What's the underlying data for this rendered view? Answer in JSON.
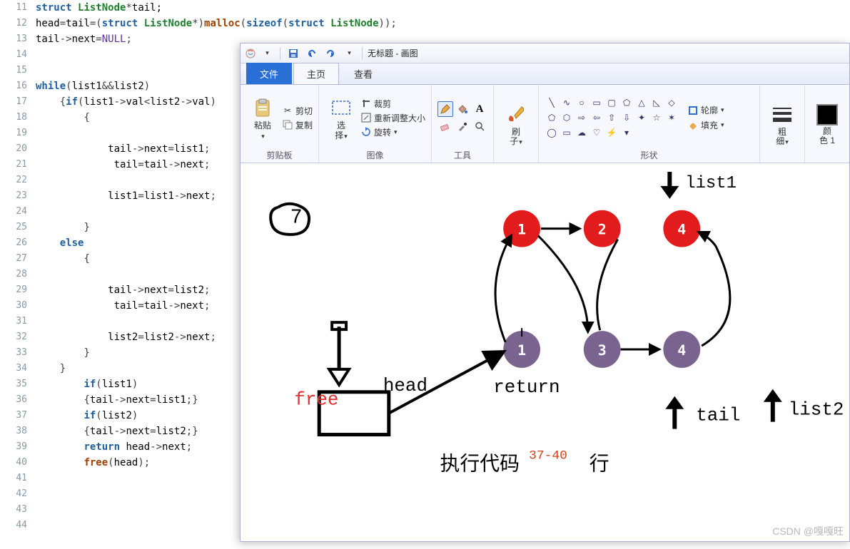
{
  "code": {
    "lines": [
      {
        "n": 11,
        "html": "<span class='kw'>struct</span> <span class='tp'>ListNode</span><span class='op'>*</span><span class='pln'>tail;</span>"
      },
      {
        "n": 12,
        "html": "<span class='pln'>head</span><span class='op'>=</span><span class='pln'>tail</span><span class='op'>=(</span><span class='kw'>struct</span> <span class='tp'>ListNode</span><span class='op'>*)</span><span class='fn'>malloc</span><span class='op'>(</span><span class='kw'>sizeof</span><span class='op'>(</span><span class='kw'>struct</span> <span class='tp'>ListNode</span><span class='op'>));</span>"
      },
      {
        "n": 13,
        "html": "<span class='pln'>tail</span><span class='op'>-&gt;</span><span class='pln'>next</span><span class='op'>=</span><span class='cnst'>NULL</span><span class='op'>;</span>"
      },
      {
        "n": 14,
        "html": ""
      },
      {
        "n": 15,
        "html": ""
      },
      {
        "n": 16,
        "html": "<span class='kw'>while</span><span class='op'>(</span><span class='pln'>list1</span><span class='op'>&amp;&amp;</span><span class='pln'>list2</span><span class='op'>)</span>"
      },
      {
        "n": 17,
        "html": "    <span class='op'>{</span><span class='kw'>if</span><span class='op'>(</span><span class='pln'>list1</span><span class='op'>-&gt;</span><span class='pln'>val</span><span class='op'>&lt;</span><span class='pln'>list2</span><span class='op'>-&gt;</span><span class='pln'>val</span><span class='op'>)</span>"
      },
      {
        "n": 18,
        "html": "        <span class='op'>{</span>"
      },
      {
        "n": 19,
        "html": ""
      },
      {
        "n": 20,
        "html": "            <span class='pln'>tail</span><span class='op'>-&gt;</span><span class='pln'>next</span><span class='op'>=</span><span class='pln'>list1</span><span class='op'>;</span>"
      },
      {
        "n": 21,
        "html": "             <span class='pln'>tail</span><span class='op'>=</span><span class='pln'>tail</span><span class='op'>-&gt;</span><span class='pln'>next</span><span class='op'>;</span>"
      },
      {
        "n": 22,
        "html": ""
      },
      {
        "n": 23,
        "html": "            <span class='pln'>list1</span><span class='op'>=</span><span class='pln'>list1</span><span class='op'>-&gt;</span><span class='pln'>next</span><span class='op'>;</span>"
      },
      {
        "n": 24,
        "html": ""
      },
      {
        "n": 25,
        "html": "        <span class='op'>}</span>"
      },
      {
        "n": 26,
        "html": "    <span class='kw'>else</span>"
      },
      {
        "n": 27,
        "html": "        <span class='op'>{</span>"
      },
      {
        "n": 28,
        "html": ""
      },
      {
        "n": 29,
        "html": "            <span class='pln'>tail</span><span class='op'>-&gt;</span><span class='pln'>next</span><span class='op'>=</span><span class='pln'>list2</span><span class='op'>;</span>"
      },
      {
        "n": 30,
        "html": "             <span class='pln'>tail</span><span class='op'>=</span><span class='pln'>tail</span><span class='op'>-&gt;</span><span class='pln'>next</span><span class='op'>;</span>"
      },
      {
        "n": 31,
        "html": ""
      },
      {
        "n": 32,
        "html": "            <span class='pln'>list2</span><span class='op'>=</span><span class='pln'>list2</span><span class='op'>-&gt;</span><span class='pln'>next</span><span class='op'>;</span>"
      },
      {
        "n": 33,
        "html": "        <span class='op'>}</span>"
      },
      {
        "n": 34,
        "html": "    <span class='op'>}</span>"
      },
      {
        "n": 35,
        "html": "        <span class='kw'>if</span><span class='op'>(</span><span class='pln'>list1</span><span class='op'>)</span>"
      },
      {
        "n": 36,
        "html": "        <span class='op'>{</span><span class='pln'>tail</span><span class='op'>-&gt;</span><span class='pln'>next</span><span class='op'>=</span><span class='pln'>list1</span><span class='op'>;}</span>"
      },
      {
        "n": 37,
        "html": "        <span class='kw'>if</span><span class='op'>(</span><span class='pln'>list2</span><span class='op'>)</span>"
      },
      {
        "n": 38,
        "html": "        <span class='op'>{</span><span class='pln'>tail</span><span class='op'>-&gt;</span><span class='pln'>next</span><span class='op'>=</span><span class='pln'>list2</span><span class='op'>;}</span>"
      },
      {
        "n": 39,
        "html": "        <span class='kw'>return</span> <span class='pln'>head</span><span class='op'>-&gt;</span><span class='pln'>next</span><span class='op'>;</span>"
      },
      {
        "n": 40,
        "html": "        <span class='fn'>free</span><span class='op'>(</span><span class='pln'>head</span><span class='op'>);</span>"
      },
      {
        "n": 41,
        "html": ""
      },
      {
        "n": 42,
        "html": ""
      },
      {
        "n": 43,
        "html": ""
      },
      {
        "n": 44,
        "html": ""
      }
    ]
  },
  "paint": {
    "title": "无标题 - 画图",
    "tabs": {
      "file": "文件",
      "home": "主页",
      "view": "查看"
    },
    "groups": {
      "clipboard": {
        "label": "剪贴板",
        "paste": "粘贴",
        "cut": "剪切",
        "copy": "复制"
      },
      "image": {
        "label": "图像",
        "select": "选\n择",
        "crop": "裁剪",
        "resize": "重新调整大小",
        "rotate": "旋转"
      },
      "tools": {
        "label": "工具"
      },
      "brush": {
        "label": "刷\n子"
      },
      "shapes": {
        "label": "形状",
        "outline": "轮廓",
        "fill": "填充"
      },
      "size": {
        "label": "粗\n细"
      },
      "color": {
        "label": "颜\n色 1"
      }
    },
    "drawing": {
      "labels": {
        "list1": "list1",
        "list2": "list2",
        "tail": "tail",
        "head": "head",
        "free": "free",
        "return": "return",
        "exec": "执行代码",
        "sup": "37-40",
        "line": "行",
        "seven": "7"
      },
      "red_nodes": [
        "1",
        "2",
        "4"
      ],
      "purple_nodes": [
        "1",
        "3",
        "4"
      ]
    },
    "watermark": "CSDN @嘎嘎旺"
  }
}
